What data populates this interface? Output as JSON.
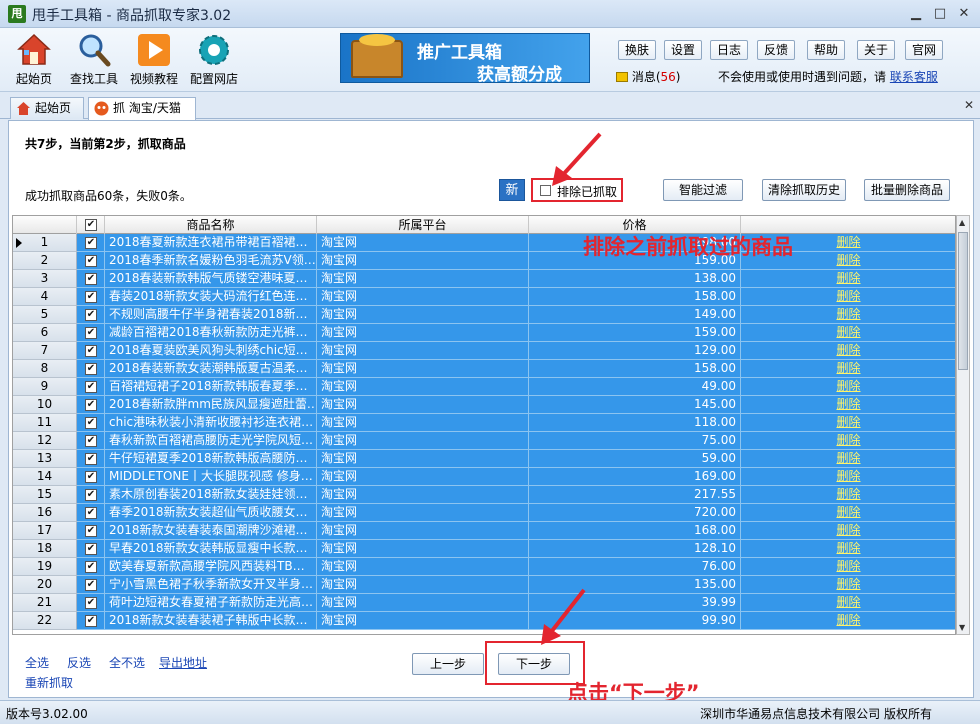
{
  "window": {
    "title": "甩手工具箱 - 商品抓取专家3.02",
    "logo": "甩"
  },
  "toolbar": [
    {
      "label": "起始页",
      "icon": "house-icon"
    },
    {
      "label": "查找工具",
      "icon": "magnifier-icon"
    },
    {
      "label": "视频教程",
      "icon": "play-icon"
    },
    {
      "label": "配置网店",
      "icon": "gear-icon"
    }
  ],
  "banner": {
    "line1": "推广工具箱",
    "line2": "获高额分成"
  },
  "top_buttons": [
    "换肤",
    "设置",
    "日志",
    "反馈",
    "帮助",
    "关于",
    "官网"
  ],
  "messages": {
    "label": "消息(",
    "count": "56",
    "suffix": ")"
  },
  "help": {
    "text": "不会使用或使用时遇到问题，请",
    "link": "联系客服"
  },
  "tabs": [
    {
      "label": "起始页",
      "icon": "house-icon"
    },
    {
      "label": "抓 淘宝/天猫",
      "icon": "taobao-icon"
    }
  ],
  "main": {
    "step_text": "共7步，当前第2步，抓取商品",
    "success_text": "成功抓取商品60条，失败0条。",
    "new_label": "新",
    "exclude_label": "排除已抓取",
    "buttons": [
      "智能过滤",
      "清除抓取历史",
      "批量删除商品"
    ],
    "annotation_top": "排除之前抓取过的商品",
    "annotation_bottom": "点击“下一步”",
    "accent_color": "#3597ea",
    "annotation_color": "#e3252f"
  },
  "table": {
    "columns": [
      "",
      "商品名称",
      "所属平台",
      "价格",
      ""
    ],
    "delete_label": "删除",
    "rows": [
      {
        "num": "1",
        "name": "2018春夏新款连衣裙吊带裙百褶裙…",
        "platform": "淘宝网",
        "price": "298.00"
      },
      {
        "num": "2",
        "name": "2018春季新款名媛粉色羽毛流苏V领…",
        "platform": "淘宝网",
        "price": "159.00"
      },
      {
        "num": "3",
        "name": "2018春装新款韩版气质镂空港味夏…",
        "platform": "淘宝网",
        "price": "138.00"
      },
      {
        "num": "4",
        "name": "春装2018新款女装大码流行红色连…",
        "platform": "淘宝网",
        "price": "158.00"
      },
      {
        "num": "5",
        "name": "不规则高腰牛仔半身裙春装2018新…",
        "platform": "淘宝网",
        "price": "149.00"
      },
      {
        "num": "6",
        "name": "减龄百褶裙2018春秋新款防走光裤…",
        "platform": "淘宝网",
        "price": "159.00"
      },
      {
        "num": "7",
        "name": "2018春夏装欧美风狗头刺绣chic短…",
        "platform": "淘宝网",
        "price": "129.00"
      },
      {
        "num": "8",
        "name": "2018春装新款女装潮韩版夏古温柔…",
        "platform": "淘宝网",
        "price": "158.00"
      },
      {
        "num": "9",
        "name": "百褶裙短裙子2018新款韩版春夏季…",
        "platform": "淘宝网",
        "price": "49.00"
      },
      {
        "num": "10",
        "name": "2018春新款胖mm民族风显瘦遮肚蕾…",
        "platform": "淘宝网",
        "price": "145.00"
      },
      {
        "num": "11",
        "name": "chic港味秋装小清新收腰衬衫连衣裙…",
        "platform": "淘宝网",
        "price": "118.00"
      },
      {
        "num": "12",
        "name": "春秋新款百褶裙高腰防走光学院风短…",
        "platform": "淘宝网",
        "price": "75.00"
      },
      {
        "num": "13",
        "name": "牛仔短裙夏季2018新款韩版高腰防…",
        "platform": "淘宝网",
        "price": "59.00"
      },
      {
        "num": "14",
        "name": "MIDDLETONE丨大长腿既视感 修身…",
        "platform": "淘宝网",
        "price": "169.00"
      },
      {
        "num": "15",
        "name": "素木原创春装2018新款女装娃娃领…",
        "platform": "淘宝网",
        "price": "217.55"
      },
      {
        "num": "16",
        "name": "春季2018新款女装超仙气质收腰女…",
        "platform": "淘宝网",
        "price": "720.00"
      },
      {
        "num": "17",
        "name": "2018新款女装春装泰国潮牌沙滩裙…",
        "platform": "淘宝网",
        "price": "168.00"
      },
      {
        "num": "18",
        "name": "早春2018新款女装韩版显瘦中长款…",
        "platform": "淘宝网",
        "price": "128.10"
      },
      {
        "num": "19",
        "name": "欧美春夏新款高腰学院风西装料TB…",
        "platform": "淘宝网",
        "price": "76.00"
      },
      {
        "num": "20",
        "name": "宁小雪黑色裙子秋季新款女开叉半身…",
        "platform": "淘宝网",
        "price": "135.00"
      },
      {
        "num": "21",
        "name": "荷叶边短裙女春夏裙子新款防走光高…",
        "platform": "淘宝网",
        "price": "39.99"
      },
      {
        "num": "22",
        "name": "2018新款女装春装裙子韩版中长款…",
        "platform": "淘宝网",
        "price": "99.90"
      }
    ]
  },
  "bottom_links": [
    "全选",
    "反选",
    "全不选",
    "导出地址",
    "重新抓取"
  ],
  "nav_buttons": {
    "prev": "上一步",
    "next": "下一步"
  },
  "status": {
    "version": "版本号3.02.00",
    "copyright": "深圳市华通易点信息技术有限公司 版权所有"
  }
}
